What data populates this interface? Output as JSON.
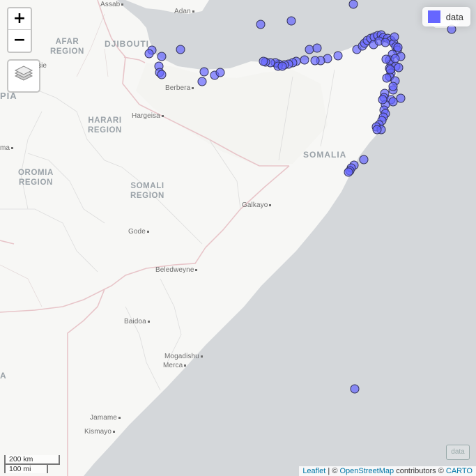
{
  "controls": {
    "zoom_in": "+",
    "zoom_out": "−"
  },
  "legend": {
    "label": "data",
    "color": "#6666ff"
  },
  "countries": {
    "djibouti": "DJIBOUTI",
    "somalia": "SOMALIA",
    "ethiopia_partial": "PIA",
    "partial_left": "A"
  },
  "regions": {
    "afar": [
      "AFAR",
      "REGION"
    ],
    "harari": [
      "HARARI",
      "REGION"
    ],
    "oromia": [
      "OROMIA",
      "REGION"
    ],
    "somali": [
      "SOMALI",
      "REGION"
    ]
  },
  "places": {
    "assab": "Assab",
    "adan": "Adan",
    "berbera": "Berbera",
    "hargeisa": "Hargeisa",
    "galkayo": "Galkayo",
    "gode": "Gode",
    "beledweyne": "Beledweyne",
    "baidoa": "Baidoa",
    "mogadishu": "Mogadishu",
    "merca": "Merca",
    "jamame": "Jamame",
    "kismayo": "Kismayo",
    "sie_partial": "sie",
    "ma_partial": "ma"
  },
  "scale": {
    "metric": "200 km",
    "imperial": "100 mi"
  },
  "mini_control": "data",
  "attribution": {
    "leaflet": "Leaflet",
    "sep": " | © ",
    "osm": "OpenStreetMap",
    "contrib": " contributors © ",
    "carto": "CARTO"
  },
  "colors": {
    "sea": "#d4d7da",
    "land": "#f6f6f4",
    "border": "#e8c4c8",
    "point_fill": "#6666ff",
    "point_stroke": "#333355"
  }
}
